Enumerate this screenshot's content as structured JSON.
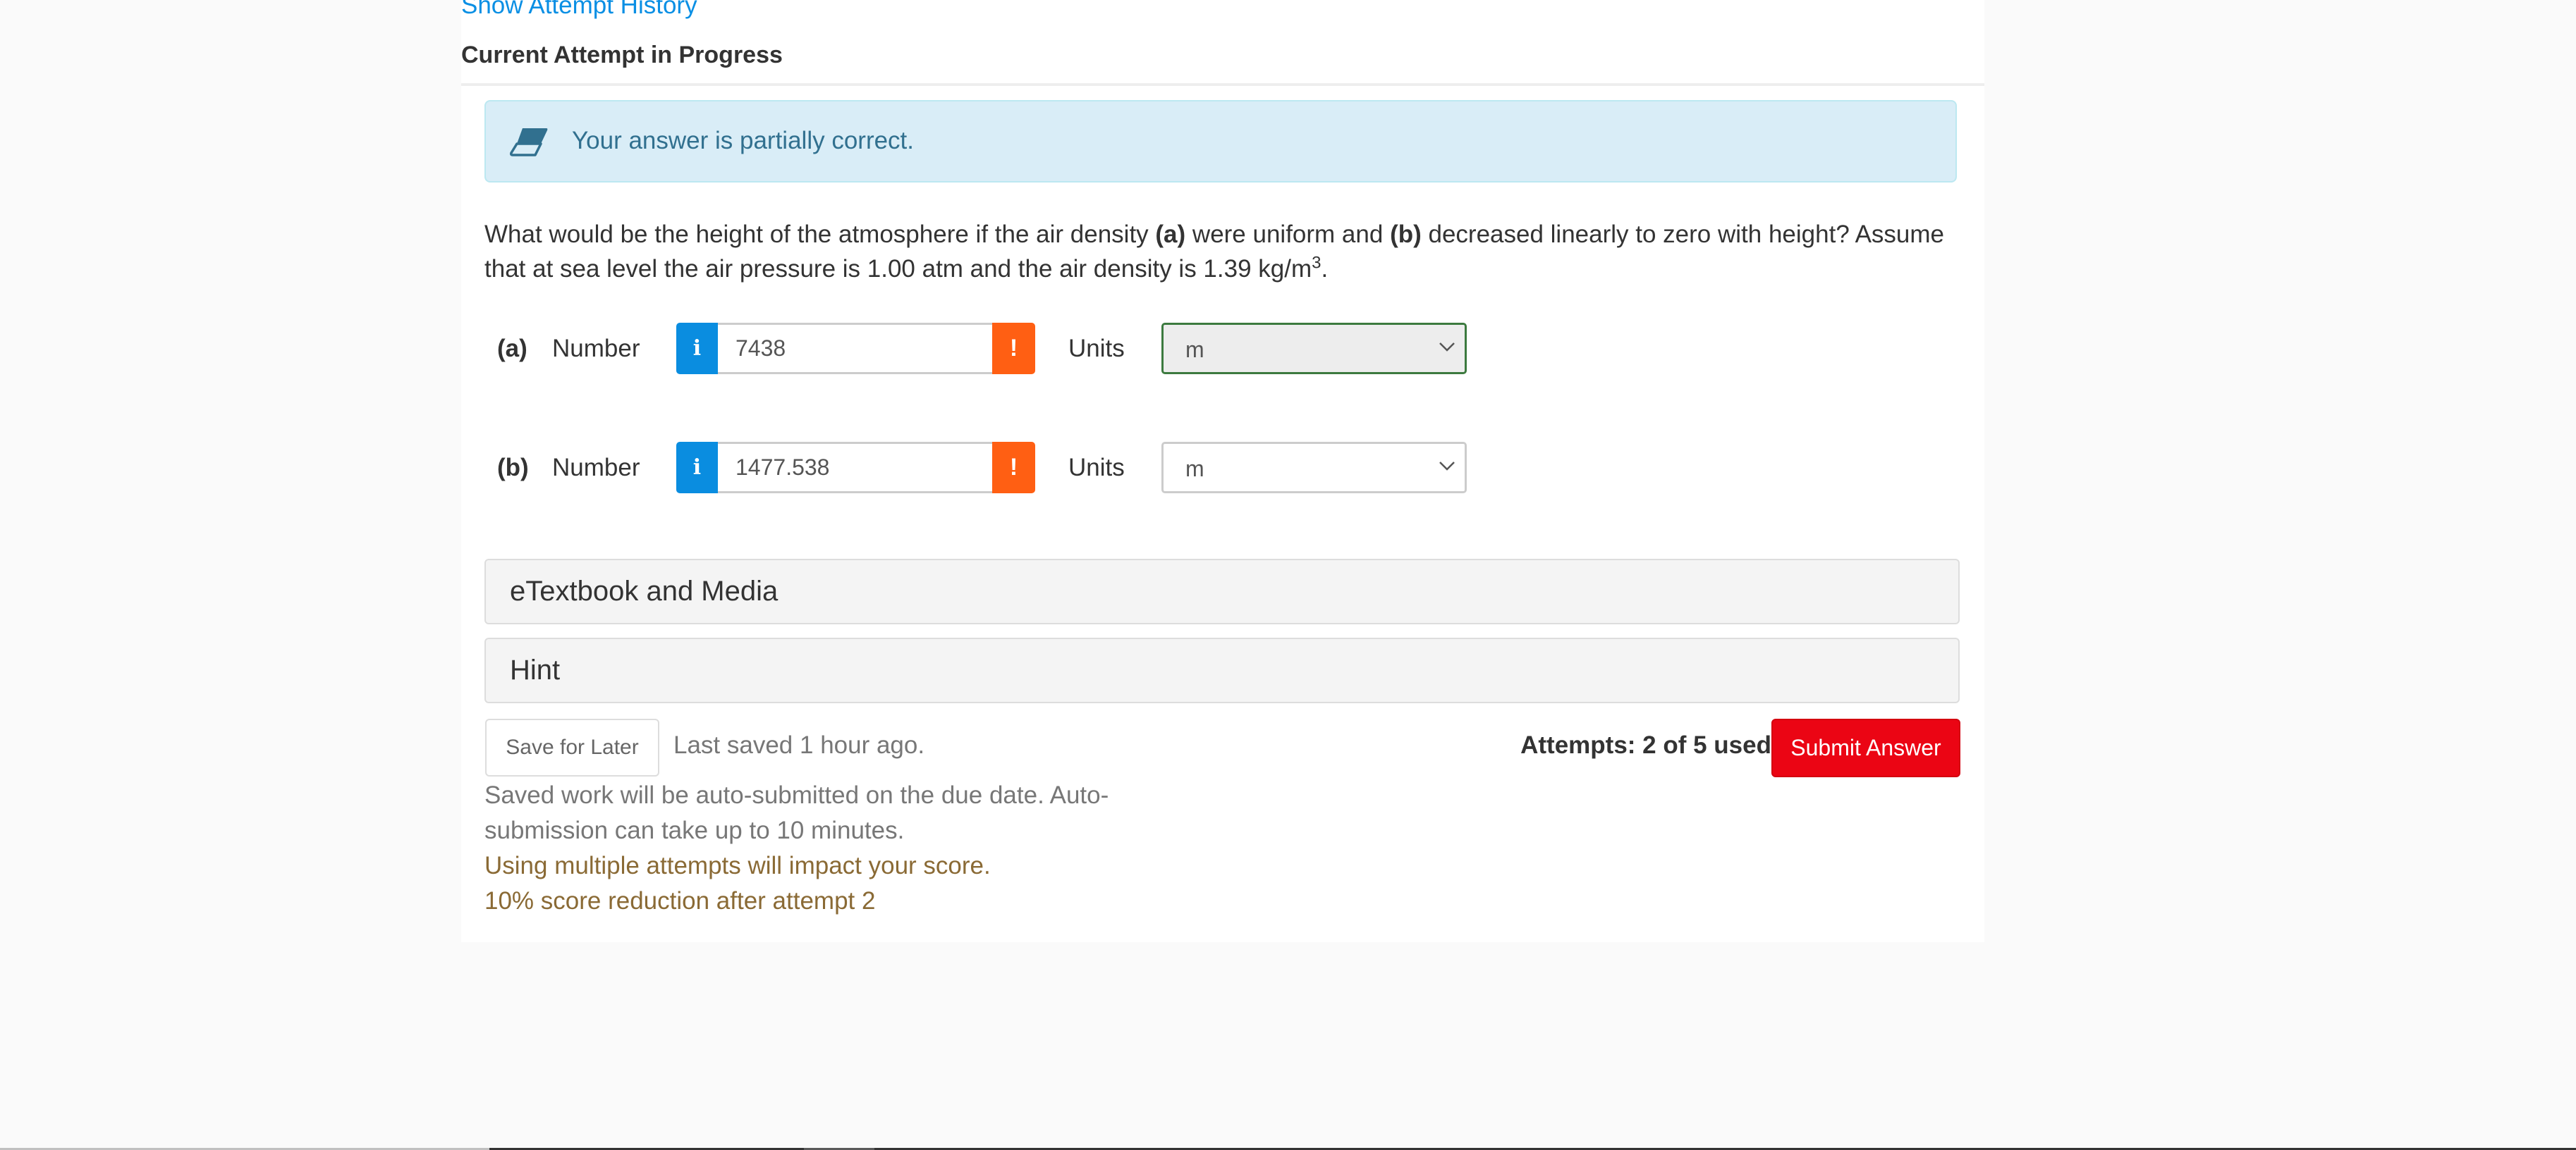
{
  "header": {
    "history_link": "Show Attempt History",
    "attempt_heading": "Current Attempt in Progress"
  },
  "alert": {
    "icon": "eraser-icon",
    "message": "Your answer is partially correct.",
    "colors": {
      "background": "#d9edf7",
      "border": "#bce8f1",
      "text": "#31708f"
    }
  },
  "question": {
    "text_1": "What would be the height of the atmosphere if the air density ",
    "bold_a": "(a)",
    "text_2": " were uniform and ",
    "bold_b": "(b)",
    "text_3": " decreased linearly to zero with height? Assume that at sea level the air pressure is 1.00 atm and the air density is 1.39 kg/m",
    "sup": "3",
    "text_4": "."
  },
  "answers": [
    {
      "part": "(a)",
      "number_label": "Number",
      "info_icon": "i",
      "value": "7438",
      "warn_icon": "!",
      "units_label": "Units",
      "units_value": "m",
      "units_status": "correct"
    },
    {
      "part": "(b)",
      "number_label": "Number",
      "info_icon": "i",
      "value": "1477.538",
      "warn_icon": "!",
      "units_label": "Units",
      "units_value": "m",
      "units_status": "unmarked"
    }
  ],
  "panels": {
    "etextbook": "eTextbook and Media",
    "hint": "Hint"
  },
  "footer": {
    "save_label": "Save for Later",
    "last_saved": "Last saved 1 hour ago.",
    "autosubmit_note": "Saved work will be auto-submitted on the due date. Auto-submission can take up to 10 minutes.",
    "penalty_line_1": "Using multiple attempts will impact your score.",
    "penalty_line_2": "10% score reduction after attempt 2",
    "attempts": "Attempts: 2 of 5 used",
    "submit_label": "Submit Answer"
  },
  "colors": {
    "link": "#0a8fe4",
    "info_button": "#0a8de0",
    "warning_button": "#ff5f13",
    "submit_button": "#eb0514",
    "correct_border": "#3c7a3f",
    "penalty_text": "#8a6a35"
  }
}
